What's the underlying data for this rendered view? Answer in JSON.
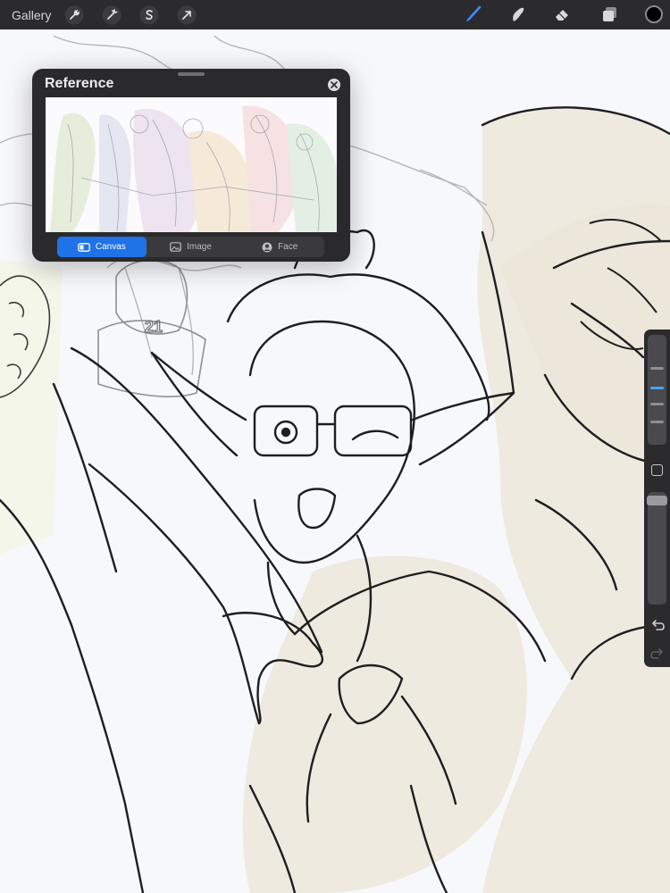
{
  "topbar": {
    "gallery_label": "Gallery",
    "left_tools": [
      {
        "name": "actions",
        "icon": "wrench-icon"
      },
      {
        "name": "adjustments",
        "icon": "magic-wand-icon"
      },
      {
        "name": "selection",
        "icon": "selection-s-icon"
      },
      {
        "name": "transform",
        "icon": "transform-arrow-icon"
      }
    ],
    "right_tools": [
      {
        "name": "brush",
        "icon": "brush-icon",
        "active": true
      },
      {
        "name": "smudge",
        "icon": "smudge-icon"
      },
      {
        "name": "eraser",
        "icon": "eraser-icon"
      },
      {
        "name": "layers",
        "icon": "layers-icon"
      }
    ],
    "current_color": "#000000"
  },
  "reference": {
    "title": "Reference",
    "tabs": [
      {
        "label": "Canvas",
        "icon": "canvas-icon",
        "active": true
      },
      {
        "label": "Image",
        "icon": "image-icon",
        "active": false
      },
      {
        "label": "Face",
        "icon": "face-icon",
        "active": false
      }
    ]
  },
  "sidebar": {
    "brush_size_level": 0.35,
    "opacity_level": 0.0,
    "buttons": [
      "modify-icon",
      "undo-icon",
      "redo-icon"
    ]
  },
  "colors": {
    "toolbar_bg": "#2b2b2d",
    "accent": "#1f73e6",
    "active_icon": "#3d8cff",
    "canvas_bg": "#f7f8fc",
    "skin_tint": "#efeadf"
  },
  "canvas_art": {
    "jersey_number": "21"
  }
}
